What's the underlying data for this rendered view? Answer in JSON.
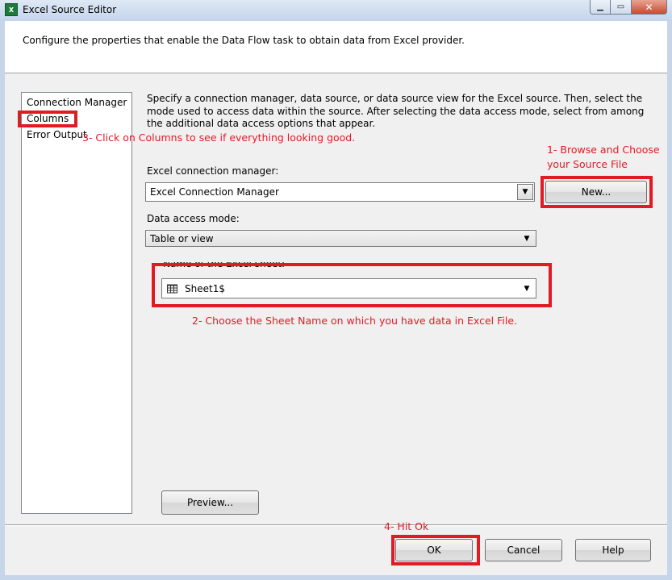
{
  "window": {
    "title": "Excel Source Editor",
    "icon_text": "X",
    "min_glyph": "▁",
    "max_glyph": "▭",
    "close_glyph": "✕"
  },
  "description": "Configure the properties that enable the Data Flow task to obtain data from Excel provider.",
  "nav": {
    "items": [
      {
        "label": "Connection Manager"
      },
      {
        "label": "Columns"
      },
      {
        "label": "Error Output"
      }
    ]
  },
  "main": {
    "instructions": "Specify a connection manager, data source, or data source view for the Excel source. Then, select the mode used to access data within the source. After selecting the data access mode, select from among the additional data access options that appear.",
    "connection_manager": {
      "label": "Excel connection manager:",
      "value": "Excel Connection Manager",
      "new_button": "New..."
    },
    "access_mode": {
      "label": "Data access mode:",
      "value": "Table or view"
    },
    "sheet": {
      "label": "Name of the Excel sheet:",
      "value": "Sheet1$"
    },
    "preview_button": "Preview..."
  },
  "footer": {
    "ok": "OK",
    "cancel": "Cancel",
    "help": "Help"
  },
  "annotations": {
    "step1_line1": "1- Browse and Choose",
    "step1_line2": "your Source File",
    "step2": "2- Choose the Sheet Name on which you have data in Excel File.",
    "step3": "3- Click on Columns to see if everything looking good.",
    "step4": "4- Hit Ok",
    "color": "#e01b24"
  },
  "arrow_glyph": "▼"
}
